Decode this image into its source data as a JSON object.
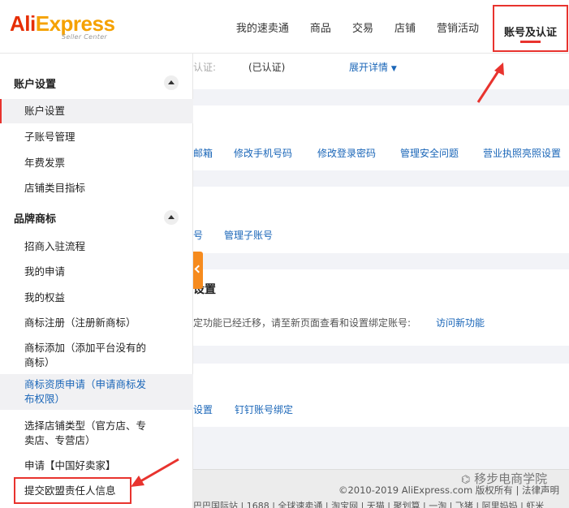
{
  "header": {
    "logo_ali": "Ali",
    "logo_express": "Express",
    "logo_sub": "Seller Center",
    "nav": [
      "我的速卖通",
      "商品",
      "交易",
      "店铺",
      "营销活动",
      "账号及认证"
    ]
  },
  "main": {
    "auth_label": "认证:",
    "auth_status": "(已认证)",
    "expand_link": "展开详情",
    "security_links": [
      "邮箱",
      "修改手机号码",
      "修改登录密码",
      "管理安全问题",
      "营业执照亮照设置"
    ],
    "subaccount_links": [
      "号",
      "管理子账号"
    ],
    "binding_title": "设置",
    "binding_text": "定功能已经迁移，请至新页面查看和设置绑定账号:",
    "binding_link": "访问新功能",
    "other_links": [
      "设置",
      "钉钉账号绑定"
    ]
  },
  "sidebar": {
    "group1_title": "账户设置",
    "group1_items": [
      "账户设置",
      "子账号管理",
      "年费发票",
      "店铺类目指标"
    ],
    "group2_title": "品牌商标",
    "group2_items": [
      "招商入驻流程",
      "我的申请",
      "我的权益",
      "商标注册（注册新商标）",
      "商标添加（添加平台没有的",
      "商标）",
      "商标资质申请（申请商标发",
      "布权限）",
      "选择店铺类型（官方店、专",
      "卖店、专营店）",
      "申请【中国好卖家】",
      "提交欧盟责任人信息"
    ]
  },
  "footer": {
    "copyright": "©2010-2019 AliExpress.com 版权所有 | 法律声明",
    "links": "巴巴国际站 | 1688 | 全球速卖通 | 淘宝网 | 天猫 | 聚划算 | 一淘 | 飞猪 | 阿里妈妈 | 虾米",
    "watermark": "移步电商学院"
  },
  "colors": {
    "accent": "#e8332e",
    "link": "#1a66b8",
    "brand_orange": "#f68b1e"
  }
}
